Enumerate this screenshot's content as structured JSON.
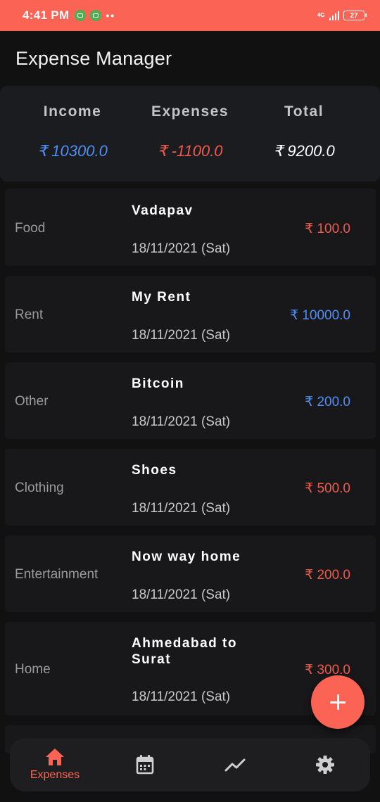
{
  "status_bar": {
    "time": "4:41 PM",
    "dots": "••",
    "network": "4G",
    "battery": "27"
  },
  "app": {
    "title": "Expense Manager"
  },
  "summary": {
    "income_label": "Income",
    "income_value": "₹ 10300.0",
    "expenses_label": "Expenses",
    "expenses_value": "₹ -1100.0",
    "total_label": "Total",
    "total_value": "₹ 9200.0"
  },
  "transactions": [
    {
      "category": "Food",
      "title": "Vadapav",
      "date": "18/11/2021 (Sat)",
      "amount": "₹ 100.0",
      "type": "expense"
    },
    {
      "category": "Rent",
      "title": "My Rent",
      "date": "18/11/2021 (Sat)",
      "amount": "₹ 10000.0",
      "type": "income"
    },
    {
      "category": "Other",
      "title": "Bitcoin",
      "date": "18/11/2021 (Sat)",
      "amount": "₹ 200.0",
      "type": "income"
    },
    {
      "category": "Clothing",
      "title": "Shoes",
      "date": "18/11/2021 (Sat)",
      "amount": "₹ 500.0",
      "type": "expense"
    },
    {
      "category": "Entertainment",
      "title": "Now way home",
      "date": "18/11/2021 (Sat)",
      "amount": "₹ 200.0",
      "type": "expense"
    },
    {
      "category": "Home",
      "title": "Ahmedabad to Surat",
      "date": "18/11/2021 (Sat)",
      "amount": "₹ 300.0",
      "type": "expense"
    }
  ],
  "nav": {
    "expenses_label": "Expenses",
    "items": [
      {
        "icon": "home-icon",
        "active": true
      },
      {
        "icon": "calendar-icon",
        "active": false
      },
      {
        "icon": "trending-icon",
        "active": false
      },
      {
        "icon": "gear-icon",
        "active": false
      }
    ]
  },
  "colors": {
    "accent": "#fb6354",
    "income": "#4f8ff5",
    "expense": "#ef5a4c",
    "background": "#111112",
    "card": "#1b1c1f"
  }
}
